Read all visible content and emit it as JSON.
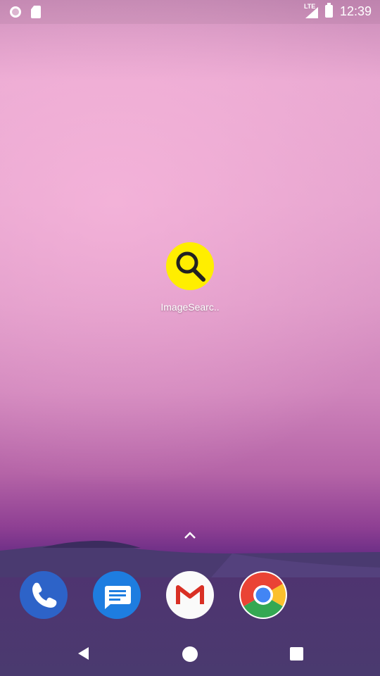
{
  "status_bar": {
    "time": "12:39",
    "network_label": "LTE",
    "icons": [
      "notification-circle-icon",
      "sd-card-icon",
      "lte-signal-icon",
      "battery-icon"
    ]
  },
  "home": {
    "apps": [
      {
        "label": "ImageSearc..",
        "icon": "magnifier-icon",
        "color": "#ffee00"
      }
    ],
    "app_drawer_hint": "chevron-up-icon"
  },
  "dock": {
    "apps": [
      {
        "name": "Phone",
        "icon": "phone-icon",
        "color": "#2d63c8"
      },
      {
        "name": "Messages",
        "icon": "messages-icon",
        "color": "#1e7de0"
      },
      {
        "name": "Gmail",
        "icon": "gmail-icon",
        "color": "#ffffff"
      },
      {
        "name": "Chrome",
        "icon": "chrome-icon",
        "color": "#4285f4"
      }
    ]
  },
  "nav_bar": {
    "buttons": [
      "back-icon",
      "home-icon",
      "recents-icon"
    ]
  }
}
